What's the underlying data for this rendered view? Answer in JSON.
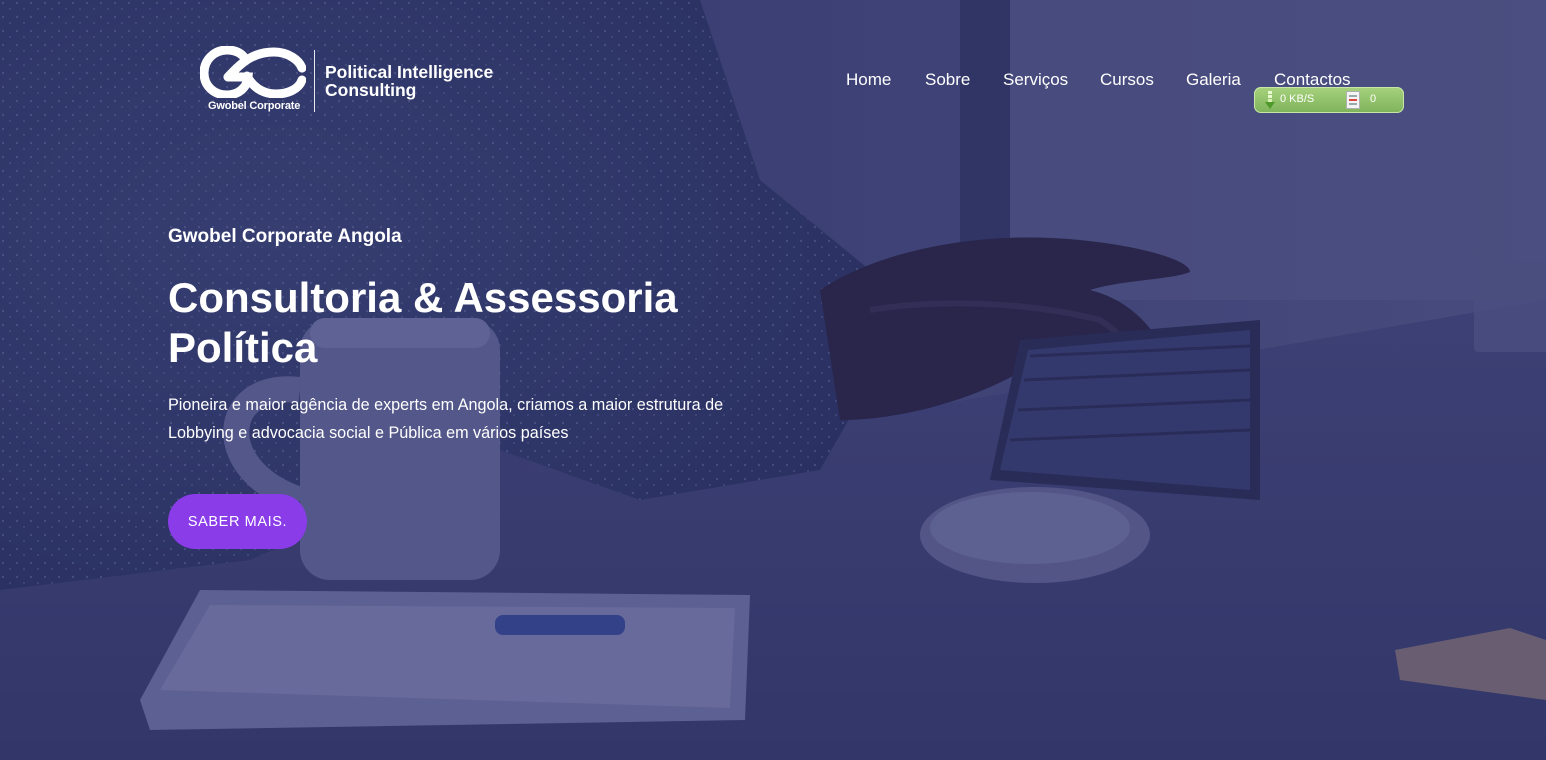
{
  "header": {
    "logo": {
      "mark": "GC",
      "company": "Gwobel Corporate",
      "tagline_line1": "Political Intelligence",
      "tagline_line2": "Consulting"
    },
    "nav": [
      {
        "label": "Home"
      },
      {
        "label": "Sobre"
      },
      {
        "label": "Serviços"
      },
      {
        "label": "Cursos"
      },
      {
        "label": "Galeria"
      },
      {
        "label": "Contactos"
      }
    ]
  },
  "speed_widget": {
    "speed": "0 KB/S",
    "task_count": "0",
    "icons": [
      "download-arrow-icon",
      "task-list-icon"
    ],
    "color": "#8cc265"
  },
  "hero": {
    "eyebrow": "Gwobel Corporate Angola",
    "headline_line1": "Consultoria & Assessoria",
    "headline_line2": "Política",
    "lead": "Pioneira e maior agência de experts em Angola, criamos a maior estrutura de Lobbying e advocacia social e Pública em vários países",
    "cta_label": "SABER MAIS."
  },
  "colors": {
    "overlay": "#2c2f6b",
    "accent": "#8a3ce9",
    "text": "#ffffff"
  }
}
